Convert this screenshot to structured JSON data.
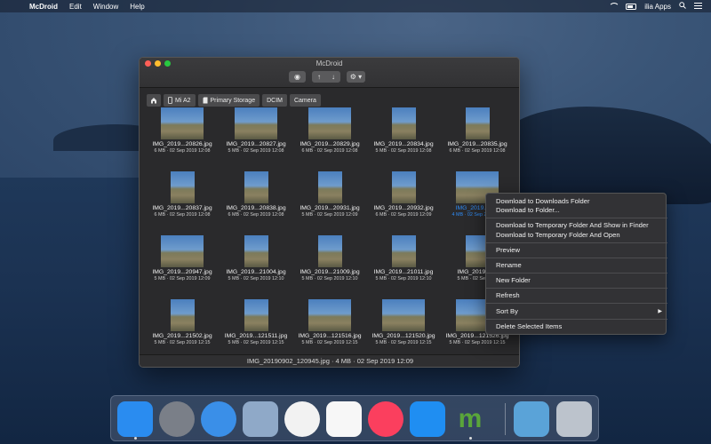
{
  "menubar": {
    "apple": "",
    "app_name": "McDroid",
    "menus": [
      "Edit",
      "Window",
      "Help"
    ],
    "user": "ilia Apps",
    "search_icon": "magnifier-icon",
    "list_icon": "menu-list-icon"
  },
  "window": {
    "title": "McDroid",
    "toolbar": {
      "eye": "◉",
      "up": "↑",
      "down": "↓",
      "gear": "⚙ ▾"
    },
    "breadcrumb": [
      {
        "label": "",
        "icon": "home-icon"
      },
      {
        "label": "Mi A2",
        "icon": "phone-icon"
      },
      {
        "label": "Primary Storage",
        "icon": "sd-card-icon"
      },
      {
        "label": "DCIM"
      },
      {
        "label": "Camera"
      }
    ],
    "files": [
      {
        "name": "IMG_2019...20826.jpg",
        "meta": "6 MB · 02 Sep 2019 12:08"
      },
      {
        "name": "IMG_2019...20827.jpg",
        "meta": "5 MB · 02 Sep 2019 12:08"
      },
      {
        "name": "IMG_2019...20829.jpg",
        "meta": "6 MB · 02 Sep 2019 12:08"
      },
      {
        "name": "IMG_2019...20834.jpg",
        "meta": "5 MB · 02 Sep 2019 12:08"
      },
      {
        "name": "IMG_2019...20835.jpg",
        "meta": "6 MB · 02 Sep 2019 12:08"
      },
      {
        "name": "IMG_2019...20837.jpg",
        "meta": "6 MB · 02 Sep 2019 12:08"
      },
      {
        "name": "IMG_2019...20838.jpg",
        "meta": "6 MB · 02 Sep 2019 12:08"
      },
      {
        "name": "IMG_2019...20931.jpg",
        "meta": "5 MB · 02 Sep 2019 12:09"
      },
      {
        "name": "IMG_2019...20932.jpg",
        "meta": "6 MB · 02 Sep 2019 12:09"
      },
      {
        "name": "IMG_2019...209",
        "meta": "4 MB · 02 Sep 2019 12:",
        "selected": true
      },
      {
        "name": "IMG_2019...20947.jpg",
        "meta": "5 MB · 02 Sep 2019 12:09"
      },
      {
        "name": "IMG_2019...21004.jpg",
        "meta": "5 MB · 02 Sep 2019 12:10"
      },
      {
        "name": "IMG_2019...21009.jpg",
        "meta": "5 MB · 02 Sep 2019 12:10"
      },
      {
        "name": "IMG_2019...21011.jpg",
        "meta": "5 MB · 02 Sep 2019 12:10"
      },
      {
        "name": "IMG_2019...21",
        "meta": "5 MB · 02 Sep 201"
      },
      {
        "name": "IMG_2019...21502.jpg",
        "meta": "5 MB · 02 Sep 2019 12:15"
      },
      {
        "name": "IMG_2019...121511.jpg",
        "meta": "5 MB · 02 Sep 2019 12:15"
      },
      {
        "name": "IMG_2019...121516.jpg",
        "meta": "5 MB · 02 Sep 2019 12:15"
      },
      {
        "name": "IMG_2019...121520.jpg",
        "meta": "5 MB · 02 Sep 2019 12:15"
      },
      {
        "name": "IMG_2019...121526.jpg",
        "meta": "5 MB · 02 Sep 2019 12:15"
      }
    ],
    "status": "IMG_20190902_120945.jpg · 4 MB · 02 Sep 2019 12:09"
  },
  "context_menu": {
    "items": [
      "Download to Downloads Folder",
      "Download to Folder...",
      "Download to Temporary Folder And Show in Finder",
      "Download to Temporary Folder And Open",
      "Preview",
      "Rename",
      "New Folder",
      "Refresh",
      "Sort By",
      "Delete Selected Items"
    ],
    "submenu_arrow": "▶"
  },
  "dock": {
    "icons": [
      {
        "name": "finder-icon",
        "color": "#2a8cf0"
      },
      {
        "name": "launchpad-icon",
        "color": "#7a7f88"
      },
      {
        "name": "safari-icon",
        "color": "#3a8fe8"
      },
      {
        "name": "preview-eagle-icon",
        "color": "#8fa9c8"
      },
      {
        "name": "photos-icon",
        "color": "#f2f2f2"
      },
      {
        "name": "reminders-icon",
        "color": "#f7f7f7"
      },
      {
        "name": "music-icon",
        "color": "#fb3f5e"
      },
      {
        "name": "app-store-icon",
        "color": "#1f8ef2"
      },
      {
        "name": "mcdroid-icon",
        "color": "#5aa53a"
      },
      {
        "name": "downloads-folder-icon",
        "color": "#5aa3d8"
      },
      {
        "name": "trash-icon",
        "color": "#bcc3cc"
      }
    ],
    "mcdroid_letter": "m"
  }
}
